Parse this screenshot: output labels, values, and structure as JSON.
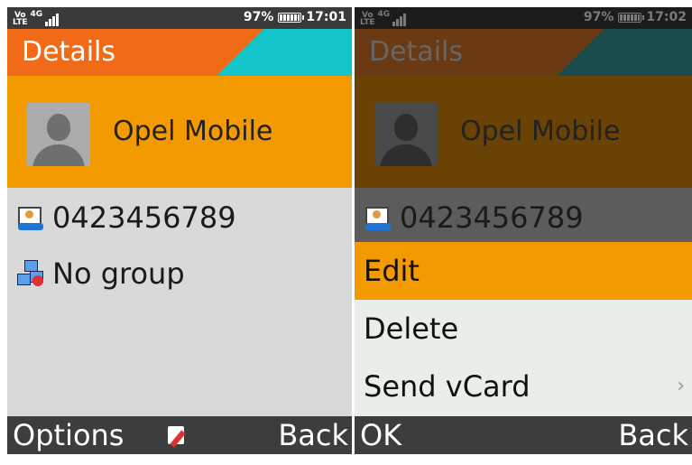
{
  "left": {
    "status": {
      "volte": "Vo",
      "lte": "LTE",
      "network": "4G",
      "battery": "97%",
      "time": "17:01"
    },
    "title": "Details",
    "contact_name": "Opel Mobile",
    "phone": "0423456789",
    "group": "No group",
    "softkeys": {
      "left": "Options",
      "right": "Back",
      "center_icon": "edit-icon"
    }
  },
  "right": {
    "status": {
      "volte": "Vo",
      "lte": "LTE",
      "network": "4G",
      "battery": "97%",
      "time": "17:02"
    },
    "title": "Details",
    "contact_name": "Opel Mobile",
    "phone": "0423456789",
    "menu": [
      {
        "label": "Edit",
        "selected": true
      },
      {
        "label": "Delete",
        "selected": false
      },
      {
        "label": "Send vCard",
        "selected": false,
        "submenu": true
      }
    ],
    "submenu_chevron": "›",
    "softkeys": {
      "left": "OK",
      "right": "Back"
    }
  },
  "colors": {
    "orange": "#f06a17",
    "teal": "#13c5c9",
    "highlight": "#f39a00"
  }
}
